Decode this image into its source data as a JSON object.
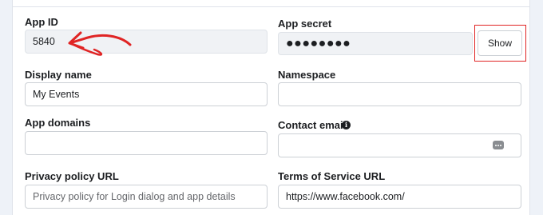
{
  "app_id": {
    "label": "App ID",
    "value": "5840"
  },
  "app_secret": {
    "label": "App secret",
    "value": "●●●●●●●●",
    "show_label": "Show"
  },
  "display_name": {
    "label": "Display name",
    "value": "My Events"
  },
  "namespace": {
    "label": "Namespace",
    "value": ""
  },
  "app_domains": {
    "label": "App domains",
    "value": ""
  },
  "contact_email": {
    "label": "Contact email",
    "value": "",
    "info_icon": "info-icon",
    "autofill_icon": "autofill-icon"
  },
  "privacy_policy_url": {
    "label": "Privacy policy URL",
    "placeholder": "Privacy policy for Login dialog and app details"
  },
  "terms_of_service_url": {
    "label": "Terms of Service URL",
    "value": "https://www.facebook.com/"
  },
  "colors": {
    "annotation": "#e02424",
    "readonly_bg": "#f0f2f5"
  }
}
